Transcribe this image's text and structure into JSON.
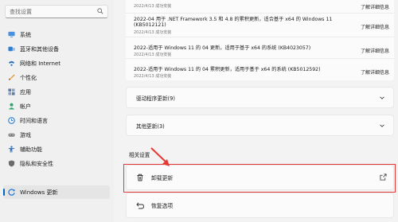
{
  "search": {
    "placeholder": "查找设置"
  },
  "nav": [
    {
      "label": "系统",
      "icon": "monitor-icon",
      "color": "#4a90e2"
    },
    {
      "label": "蓝牙和其他设备",
      "icon": "bluetooth-icon",
      "color": "#2f7fd1"
    },
    {
      "label": "网络和 Internet",
      "icon": "network-icon",
      "color": "#2f6fb8"
    },
    {
      "label": "个性化",
      "icon": "brush-icon",
      "color": "#e0922a"
    },
    {
      "label": "应用",
      "icon": "apps-icon",
      "color": "#5b7ba6"
    },
    {
      "label": "帐户",
      "icon": "account-icon",
      "color": "#30a46c"
    },
    {
      "label": "时间和语言",
      "icon": "globe-clock-icon",
      "color": "#2f7fd1"
    },
    {
      "label": "游戏",
      "icon": "gamepad-icon",
      "color": "#7a7a7a"
    },
    {
      "label": "辅助功能",
      "icon": "accessibility-icon",
      "color": "#2f6fb8"
    },
    {
      "label": "隐私和安全性",
      "icon": "shield-icon",
      "color": "#6c6c6c"
    },
    {
      "label": "Windows 更新",
      "icon": "windows-update-icon",
      "color": "#1f7adc",
      "active": true
    }
  ],
  "updates": [
    {
      "title": "",
      "date": "2022/4/13 成功安装",
      "link": "了解详细信息"
    },
    {
      "title": "2022-04 用于 .NET Framework 3.5 和 4.8 的累积更新，适合基于 x64 的 Windows 11 (KB5012121)",
      "title_line1": "2022-04 用于 .NET Framework 3.5 和 4.8 的累积更新，适合基于 x64 的 Windows 11",
      "title_line2": "(KB5012121)",
      "date": "2022/4/13 成功安装",
      "link": "了解详细信息"
    },
    {
      "title": "2022-适用于 Windows 11 的 04 更新，适用于基于 x64 的系统 (KB4023057)",
      "date": "2022/4/13 成功安装",
      "link": "了解详细信息"
    },
    {
      "title": "2022-适用于 Windows 11 的 04 累积更新，适用于基于 x64 的系统 (KB5012592)",
      "date": "2022/4/13 成功安装",
      "link": "了解详细信息"
    }
  ],
  "driver_updates": "驱动程序更新(9)",
  "other_updates": "其他更新(3)",
  "related_settings": "相关设置",
  "uninstall_updates": "卸载更新",
  "recovery": "恢复选项",
  "colors": {
    "accent": "#0067c0",
    "highlight": "#e53935"
  }
}
